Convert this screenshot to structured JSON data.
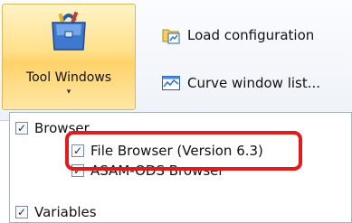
{
  "ribbon": {
    "tool_windows": {
      "label": "Tool Windows",
      "arrow": "▾",
      "icon": "toolbox-icon"
    },
    "commands": [
      {
        "label": "Load configuration",
        "icon": "load-configuration-icon"
      },
      {
        "label": "Curve window list...",
        "icon": "curve-window-list-icon"
      }
    ]
  },
  "menu": {
    "items": [
      {
        "label": "Browser",
        "checked": true,
        "indent": 0
      },
      {
        "label": "File Browser (Version 6.3)",
        "checked": true,
        "indent": 1
      },
      {
        "label": "ASAM-ODS Browser",
        "checked": true,
        "indent": 1
      },
      {
        "label": "Variables",
        "checked": true,
        "indent": 0
      }
    ],
    "check_glyph": "✓"
  },
  "annotation": {
    "color": "#e01b1b"
  }
}
